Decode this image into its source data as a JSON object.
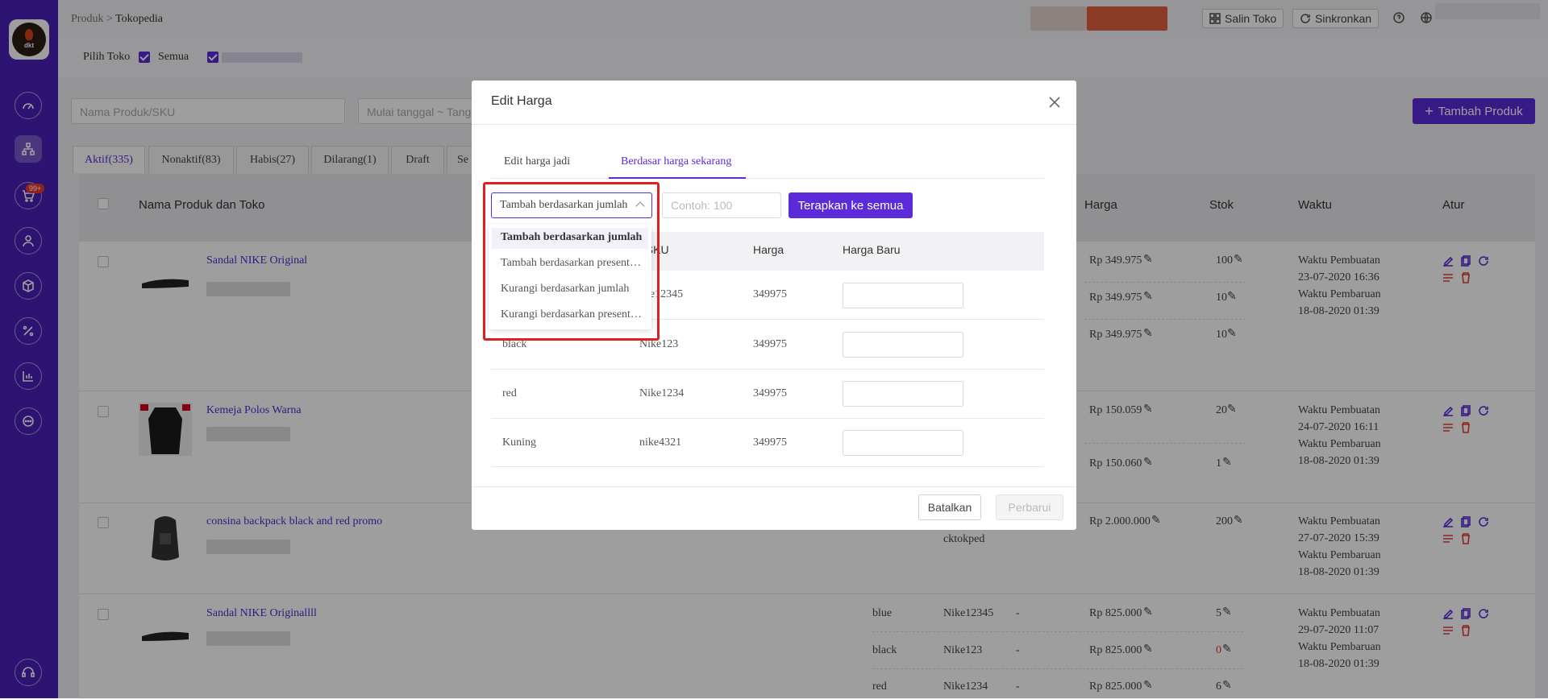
{
  "breadcrumb": {
    "root": "Produk",
    "sep": ">",
    "current": "Tokopedia"
  },
  "header": {
    "copy_store": "Salin Toko",
    "sync": "Sinkronkan"
  },
  "sidebar": {
    "cart_badge": "99+"
  },
  "store_filter": {
    "label": "Pilih Toko",
    "all": "Semua"
  },
  "filters": {
    "search_placeholder": "Nama Produk/SKU",
    "date_placeholder": "Mulai tanggal ~ Tang"
  },
  "add_product": "Tambah Produk",
  "tabs": [
    "Aktif(335)",
    "Nonaktif(83)",
    "Habis(27)",
    "Dilarang(1)",
    "Draft",
    "Se"
  ],
  "table_headers": {
    "product": "Nama Produk dan Toko",
    "price": "Harga",
    "stock": "Stok",
    "time": "Waktu",
    "actions": "Atur"
  },
  "products": [
    {
      "name": "Sandal NIKE Original",
      "prices": [
        "Rp 349.975",
        "Rp 349.975",
        "Rp 349.975"
      ],
      "stocks": [
        "100",
        "10",
        "10"
      ],
      "created_label": "Waktu Pembuatan",
      "created": "23-07-2020 16:36",
      "updated_label": "Waktu Pembaruan",
      "updated": "18-08-2020 01:39"
    },
    {
      "name": "Kemeja Polos Warna",
      "prices": [
        "Rp 150.059",
        "Rp 150.060"
      ],
      "stocks": [
        "20",
        "1"
      ],
      "created_label": "Waktu Pembuatan",
      "created": "24-07-2020 16:11",
      "updated_label": "Waktu Pembaruan",
      "updated": "18-08-2020 01:39"
    },
    {
      "name": "consina backpack black and red promo",
      "prices": [
        "Rp 2.000.000"
      ],
      "stocks": [
        "200"
      ],
      "extra": "cktokped",
      "created_label": "Waktu Pembuatan",
      "created": "27-07-2020 15:39",
      "updated_label": "Waktu Pembaruan",
      "updated": "18-08-2020 01:39"
    },
    {
      "name": "Sandal NIKE Originallll",
      "variants": [
        {
          "name": "blue",
          "sku": "Nike12345",
          "dash": "-",
          "price": "Rp 825.000",
          "stock": "5"
        },
        {
          "name": "black",
          "sku": "Nike123",
          "dash": "-",
          "price": "Rp 825.000",
          "stock": "0"
        },
        {
          "name": "red",
          "sku": "Nike1234",
          "dash": "-",
          "price": "Rp 825.000",
          "stock": "6"
        }
      ],
      "created_label": "Waktu Pembuatan",
      "created": "29-07-2020 11:07",
      "updated_label": "Waktu Pembaruan",
      "updated": "18-08-2020 01:39"
    }
  ],
  "modal": {
    "title": "Edit Harga",
    "tabs": [
      "Edit harga jadi",
      "Berdasar harga sekarang"
    ],
    "select_value": "Tambah berdasarkan jumlah",
    "amount_placeholder": "Contoh: 100",
    "apply": "Terapkan ke semua",
    "columns": [
      "t SKU",
      "Harga",
      "Harga Baru"
    ],
    "rows": [
      {
        "variant": "",
        "sku": "ike12345",
        "price": "349975"
      },
      {
        "variant": "black",
        "sku": "Nike123",
        "price": "349975"
      },
      {
        "variant": "red",
        "sku": "Nike1234",
        "price": "349975"
      },
      {
        "variant": "Kuning",
        "sku": "nike4321",
        "price": "349975"
      }
    ],
    "cancel": "Batalkan",
    "update": "Perbarui",
    "dropdown_options": [
      "Tambah berdasarkan jumlah",
      "Tambah berdasarkan present…",
      "Kurangi berdasarkan jumlah",
      "Kurangi berdasarkan present…"
    ]
  },
  "colors": {
    "primary": "#5b2bd9",
    "sidebar": "#4a1fb8",
    "danger": "#e53935"
  }
}
